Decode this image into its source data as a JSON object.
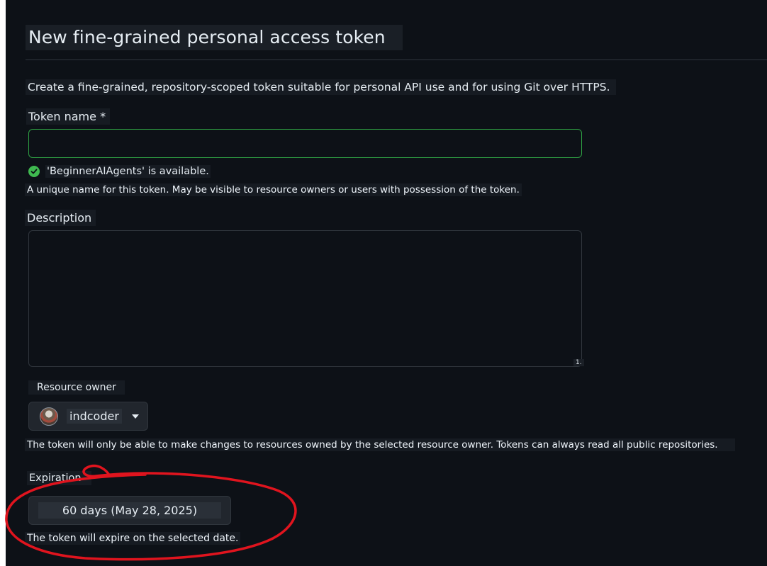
{
  "page": {
    "title": "New fine-grained personal access token",
    "subtitle": "Create a fine-grained, repository-scoped token suitable for personal API use and for using Git over HTTPS."
  },
  "token_name": {
    "label": "Token name *",
    "value": "",
    "available_text": "'BeginnerAIAgents' is available.",
    "note": "A unique name for this token. May be visible to resource owners or users with possession of the token."
  },
  "description": {
    "label": "Description",
    "value": "",
    "resize_mark": "1."
  },
  "resource_owner": {
    "label": "Resource owner",
    "selected": "indcoder",
    "note": "The token will only be able to make changes to resources owned by the selected resource owner. Tokens can always read all public repositories."
  },
  "expiration": {
    "label": "Expiration",
    "selected": "60 days (May 28, 2025)",
    "note": "The token will expire on the selected date."
  },
  "colors": {
    "background": "#0d1117",
    "valid_border": "#2ea043",
    "success_icon": "#3fb950",
    "annotation": "#e0141e"
  },
  "icons": {
    "available": "check-circle-icon",
    "owner_avatar": "avatar",
    "owner_dropdown": "triangle-down-icon"
  }
}
